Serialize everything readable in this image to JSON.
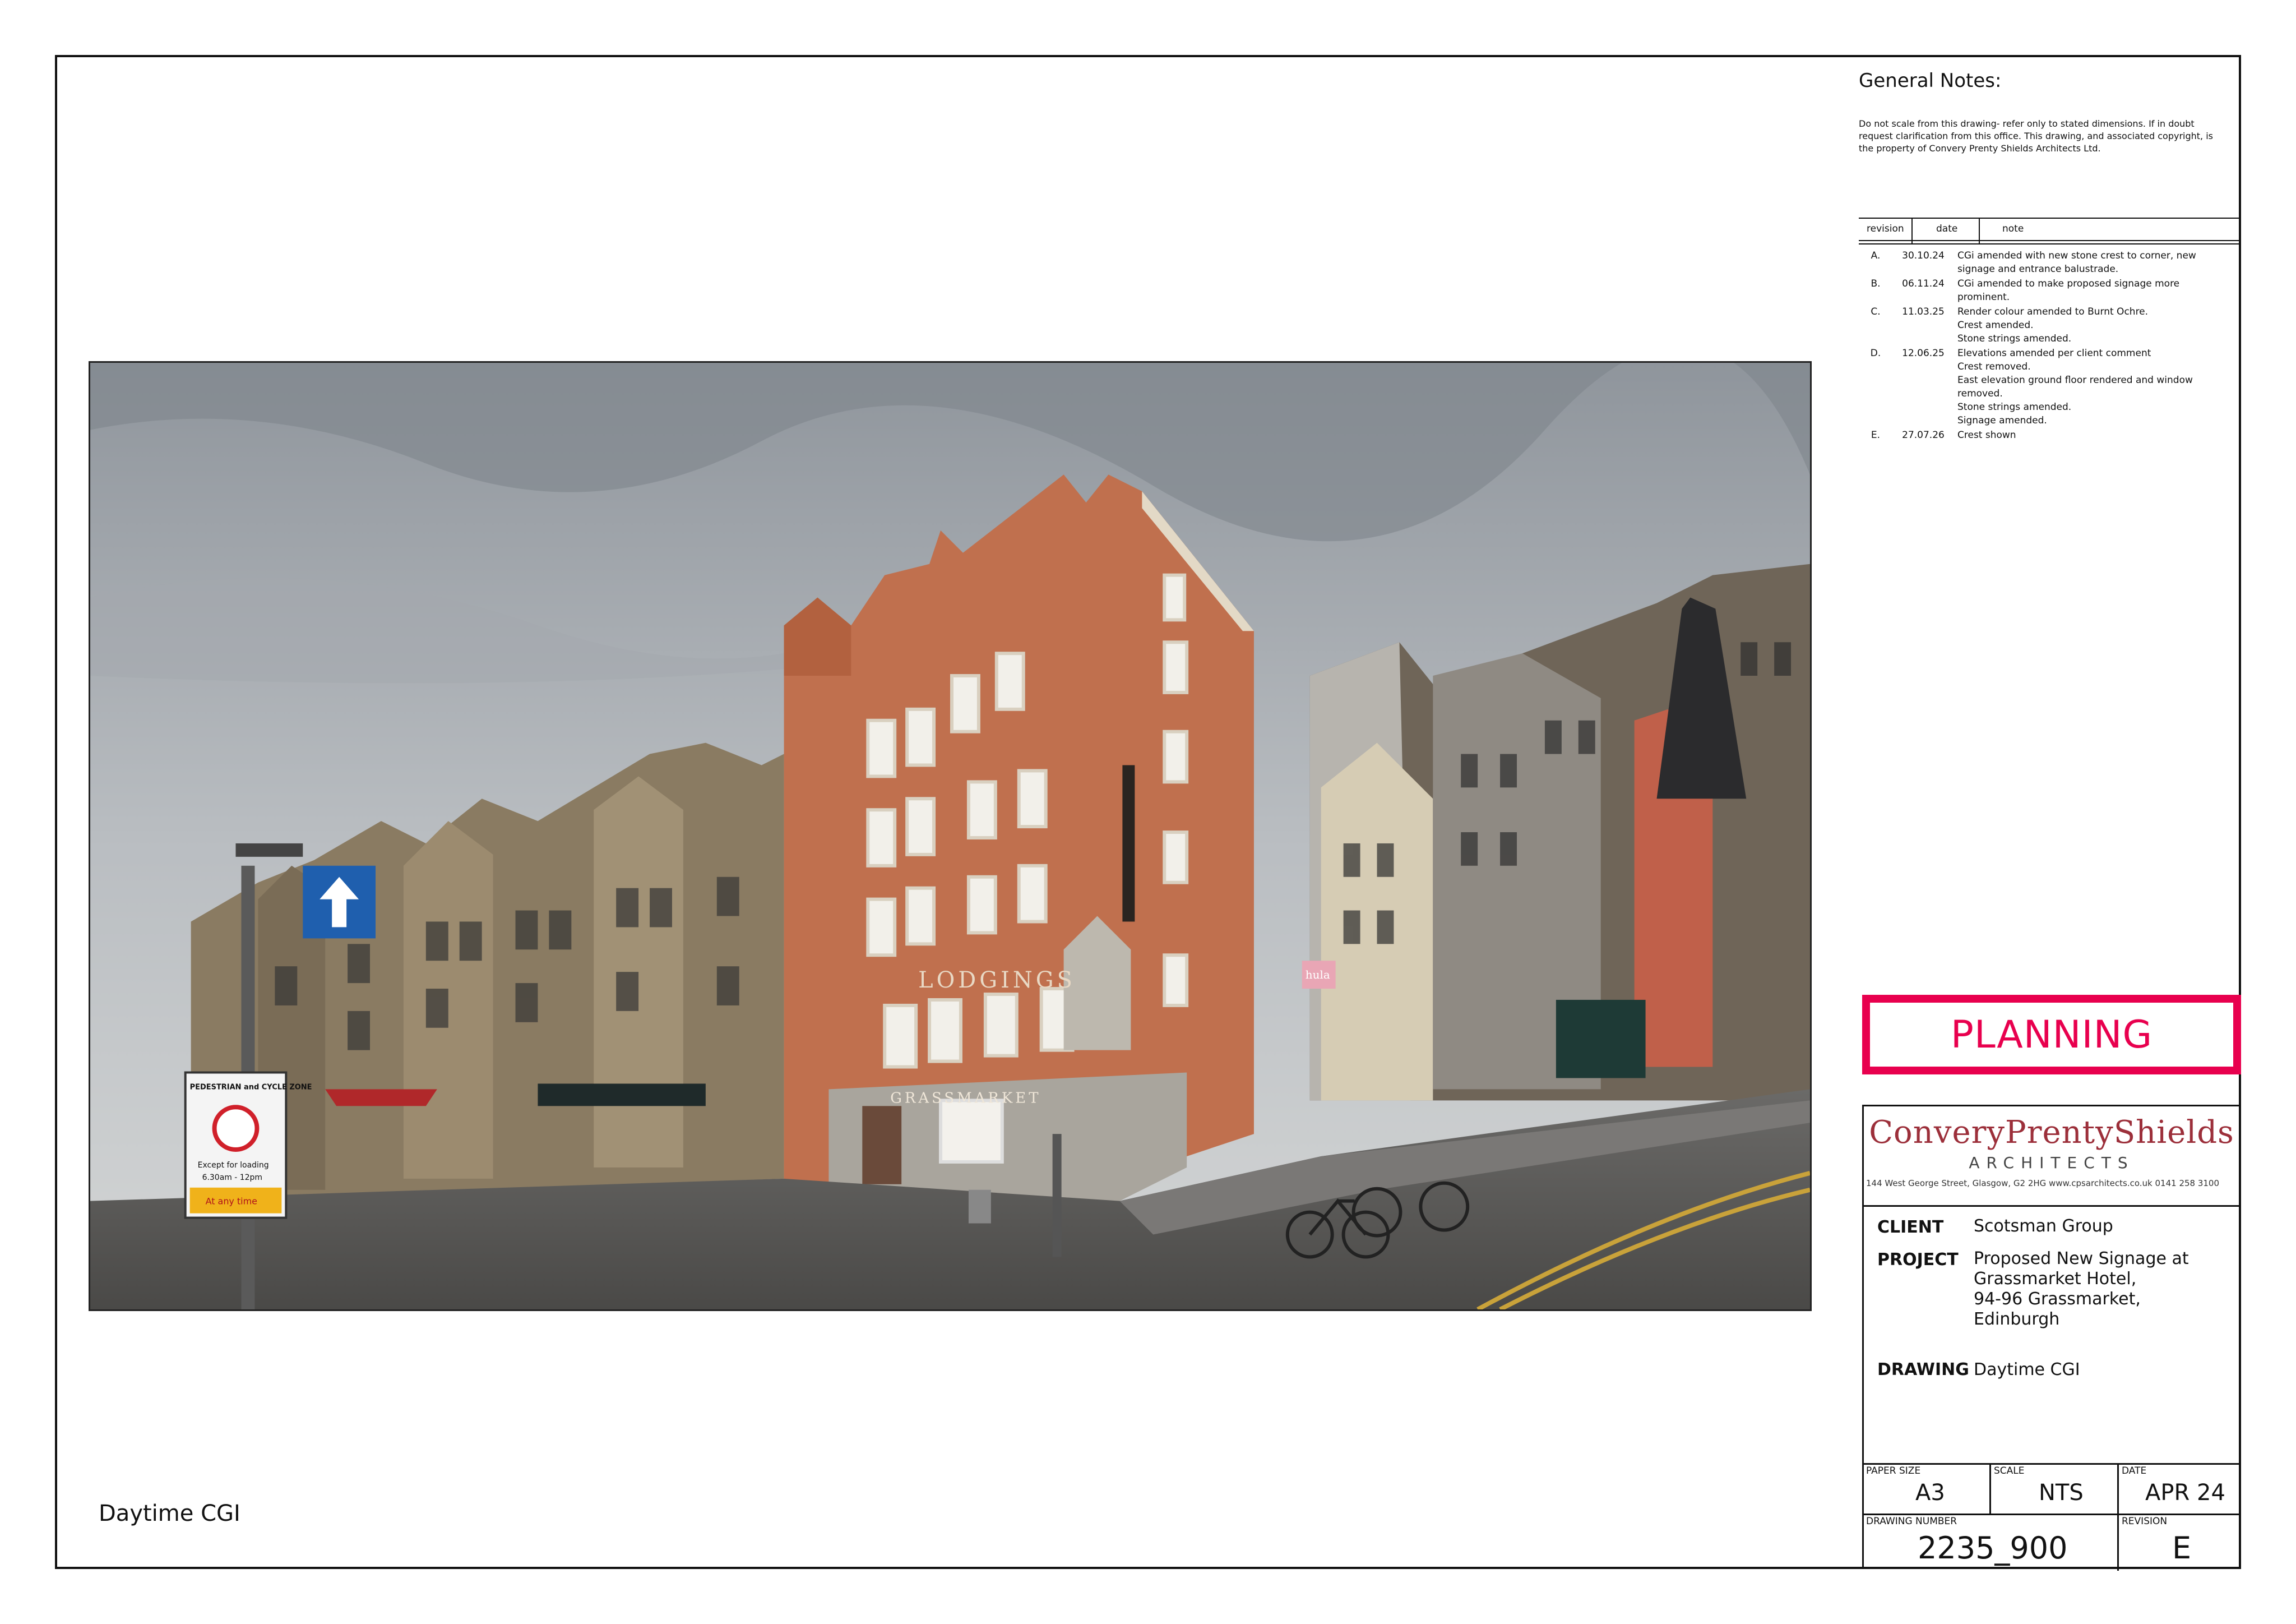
{
  "general_notes": {
    "title": "General Notes:",
    "text": "Do not scale from this drawing- refer only to stated dimensions. If in doubt request clarification from this office. This drawing, and associated copyright, is the property of Convery Prenty Shields Architects Ltd."
  },
  "revisions": {
    "headers": [
      "revision",
      "date",
      "note"
    ],
    "rows": [
      {
        "rev": "A.",
        "date": "30.10.24",
        "note": "CGi amended with new stone crest to corner, new signage and entrance balustrade."
      },
      {
        "rev": "B.",
        "date": "06.11.24",
        "note": "CGi amended to make proposed signage more prominent."
      },
      {
        "rev": "C.",
        "date": "11.03.25",
        "note": "Render colour amended to Burnt Ochre.\nCrest amended.\nStone strings amended."
      },
      {
        "rev": "D.",
        "date": "12.06.25",
        "note": "Elevations amended per client comment\nCrest removed.\nEast elevation ground floor rendered and window removed.\nStone strings amended.\nSignage amended."
      },
      {
        "rev": "E.",
        "date": "27.07.26",
        "note": "Crest shown"
      }
    ]
  },
  "stamp": "PLANNING",
  "practice": {
    "name": "ConveryPrentyShields",
    "subtitle": "ARCHITECTS",
    "address": "144 West George Street, Glasgow, G2 2HG  www.cpsarchitects.co.uk  0141 258 3100"
  },
  "client": {
    "label": "CLIENT",
    "value": "Scotsman Group"
  },
  "project": {
    "label": "PROJECT",
    "lines": [
      "Proposed New Signage at",
      "Grassmarket Hotel,",
      "94-96 Grassmarket,",
      "Edinburgh"
    ]
  },
  "drawing": {
    "label": "DRAWING",
    "value": "Daytime CGI"
  },
  "paper_size": {
    "label": "PAPER SIZE",
    "value": "A3"
  },
  "scale": {
    "label": "SCALE",
    "value": "NTS"
  },
  "date": {
    "label": "DATE",
    "value": "APR 24"
  },
  "drawing_number": {
    "label": "DRAWING NUMBER",
    "value": "2235_900"
  },
  "revision": {
    "label": "REVISION",
    "value": "E"
  },
  "caption": "Daytime CGI",
  "image_text": {
    "sign_lodgings": "LODGINGS",
    "sign_grassmarket": "GRASSMARKET",
    "zone_sign": "PEDESTRIAN and CYCLE ZONE",
    "zone_except": "Except for loading",
    "zone_times": "6.30am - 12pm",
    "zone_atany": "At any time",
    "shop_sign": "hula"
  },
  "colors": {
    "stamp": "#e8004e",
    "brand": "#9c2f3a",
    "render": "#c0704e"
  }
}
